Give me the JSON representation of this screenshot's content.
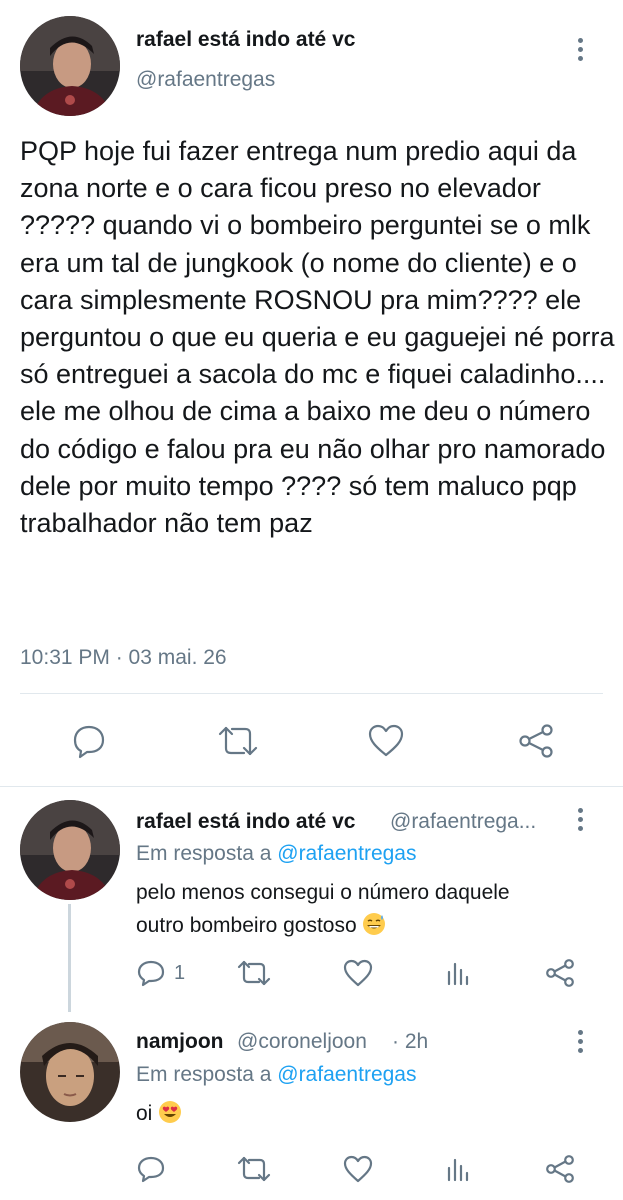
{
  "main_tweet": {
    "author_name": "rafael está indo até vc",
    "author_handle": "@rafaentregas",
    "text": "PQP hoje fui fazer entrega num predio aqui da zona norte e o cara ficou preso no elevador ????? quando vi o bombeiro perguntei se o mlk era um tal de jungkook (o nome do cliente) e o cara simplesmente ROSNOU pra mim???? ele perguntou o que eu queria e eu gaguejei né porra só entreguei a sacola do mc e fiquei caladinho.... ele me olhou de cima a baixo me deu o número do código e falou pra eu não olhar pro namorado dele por muito tempo ???? só tem maluco pqp trabalhador não tem paz",
    "timestamp": "10:31 PM · 03 mai. 26",
    "actions": [
      "reply-icon",
      "retweet-icon",
      "like-icon",
      "share-icon"
    ]
  },
  "replies": [
    {
      "author_name": "rafael está indo até vc",
      "author_handle": "@rafaentrega...",
      "reply_prefix": "Em resposta a",
      "reply_target": "@rafaentregas",
      "text_line1": "pelo menos consegui o número daquele",
      "text_line2": "outro bombeiro gostoso",
      "emoji": "grinning-sweat-emoji",
      "reply_count": "1",
      "actions": [
        "reply-icon",
        "retweet-icon",
        "like-icon",
        "stats-icon",
        "share-icon"
      ]
    },
    {
      "author_name": "namjoon",
      "author_handle": "@coroneljoon",
      "time": "· 2h",
      "reply_prefix": "Em resposta a",
      "reply_target": "@rafaentregas",
      "text": "oi",
      "emoji": "heart-eyes-emoji",
      "actions": [
        "reply-icon",
        "retweet-icon",
        "like-icon",
        "stats-icon",
        "share-icon"
      ]
    }
  ],
  "colors": {
    "text": "#14171a",
    "secondary": "#657786",
    "link": "#1da1f2",
    "divider": "#e1e8ed"
  }
}
